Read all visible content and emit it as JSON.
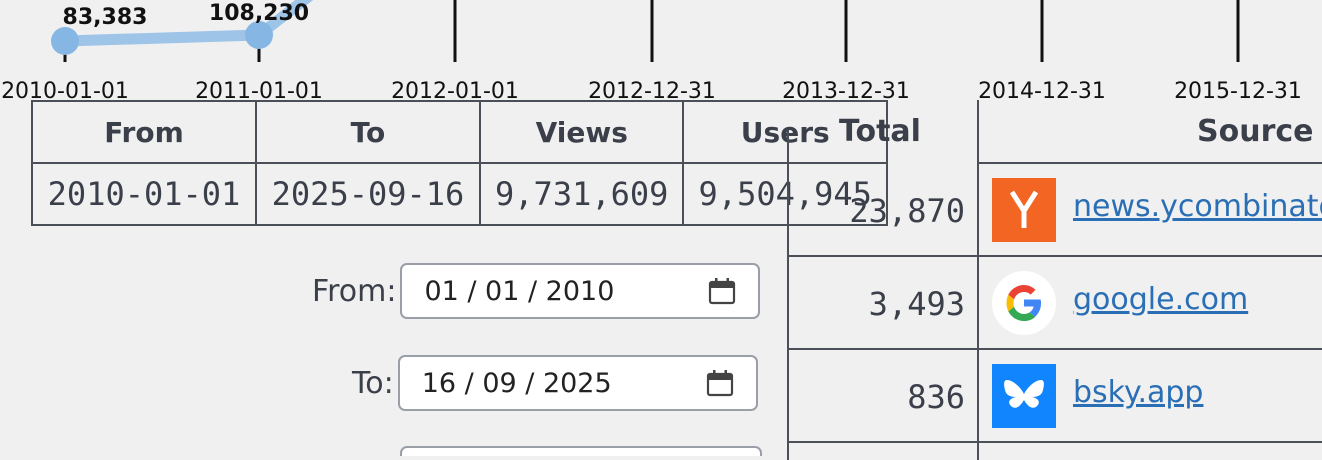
{
  "chart_data": {
    "type": "line",
    "x": [
      "2010-01-01",
      "2011-01-01"
    ],
    "values": [
      83383,
      108230
    ],
    "point_labels": [
      "83,383",
      "108,230"
    ],
    "tick_labels": [
      "2010-01-01",
      "2011-01-01",
      "2012-01-01",
      "2012-12-31",
      "2013-12-31",
      "2014-12-31",
      "2015-12-31"
    ],
    "line_color": "#9ec4e8",
    "point_color": "#86b6e4"
  },
  "summary": {
    "headers": [
      "From",
      "To",
      "Views",
      "Users"
    ],
    "from": "2010-01-01",
    "to": "2025-09-16",
    "views": "9,731,609",
    "users": "9,504,945"
  },
  "form": {
    "from_label": "From:",
    "from_value": "01 / 01 / 2010",
    "to_label": "To:",
    "to_value": "16 / 09 / 2025"
  },
  "sources": {
    "headers": {
      "total": "Total",
      "source": "Source"
    },
    "rows": [
      {
        "total": "23,870",
        "name": "news.ycombinato",
        "icon": "ycombinator-icon"
      },
      {
        "total": "3,493",
        "name": "google.com",
        "icon": "google-icon"
      },
      {
        "total": "836",
        "name": "bsky.app",
        "icon": "bluesky-icon"
      }
    ]
  },
  "colors": {
    "ycombinator": "#f26522",
    "bluesky": "#1185fe",
    "link": "#2a6fb5"
  }
}
